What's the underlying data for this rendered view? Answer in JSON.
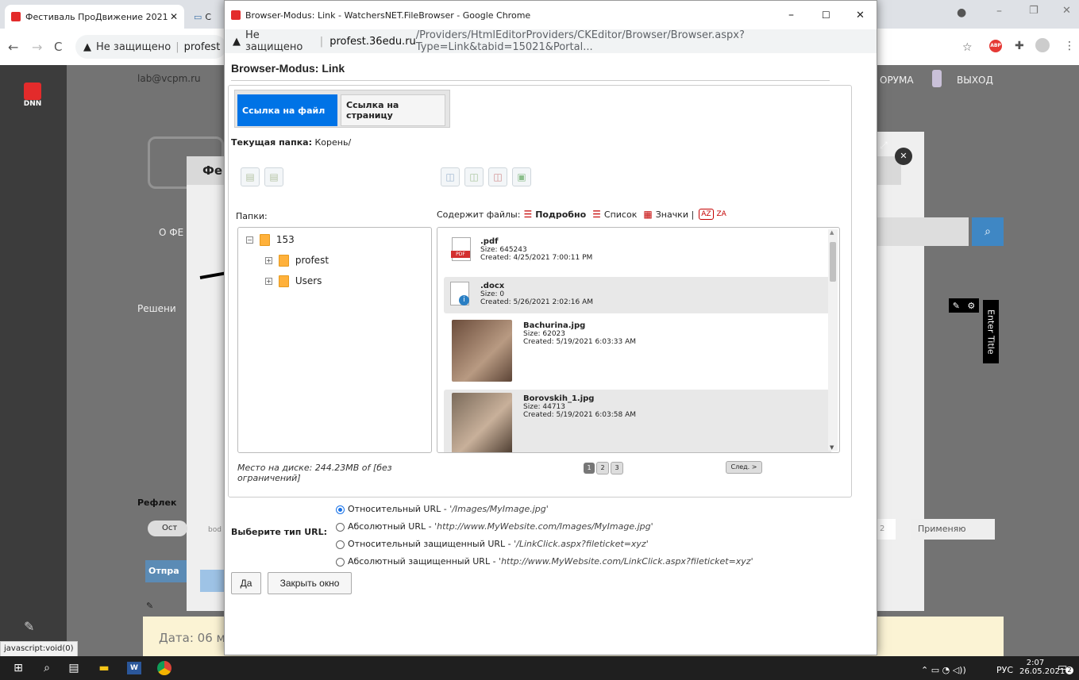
{
  "browser": {
    "tab1_title": "Фестиваль ПроДвижение 2021",
    "tab2_title": "С",
    "address_prefix": "Не защищено",
    "address_text": "profest",
    "status_bar": "javascript:void(0)"
  },
  "background_page": {
    "email": "lab@vcpm.ru",
    "forum_link": "ОРУМА",
    "logout": "ВЫХОД",
    "dnn_label": "DNN",
    "about_fragment": "О ФЕ",
    "decision_fragment": "Решени",
    "reflex_fragment": "Рефлек",
    "ost_fragment": "Ост",
    "send_fragment": "Отпра",
    "date_fragment": "Дата: 06 м",
    "apply_fragment": "Применяю",
    "enter_title": "Enter Title",
    "bod_fragment": "bod",
    "fe_fragment": "Фе",
    "num2": "2"
  },
  "popup": {
    "window_title": "Browser-Modus: Link - WatchersNET.FileBrowser - Google Chrome",
    "address_warning": "Не защищено",
    "url_host": "profest.36edu.ru",
    "url_path": "/Providers/HtmlEditorProviders/CKEditor/Browser/Browser.aspx?Type=Link&tabid=15021&Portal...",
    "heading": "Browser-Modus: Link",
    "tab_file": "Ссылка на файл",
    "tab_page_line1": "Ссылка на",
    "tab_page_line2": "страницу",
    "current_folder_label": "Текущая папка:",
    "current_folder_value": "Корень/",
    "folders_label": "Папки:",
    "files_label": "Содержит файлы:",
    "view_detail": "Подробно",
    "view_list": "Список",
    "view_icons": "Значки |",
    "tree": {
      "root": "153",
      "children": [
        "profest",
        "Users"
      ]
    },
    "files": [
      {
        "name": ".pdf",
        "size": "Size: 645243",
        "created": "Created: 4/25/2021 7:00:11 PM",
        "type": "pdf"
      },
      {
        "name": ".docx",
        "size": "Size: 0",
        "created": "Created: 5/26/2021 2:02:16 AM",
        "type": "doc"
      },
      {
        "name": "Bachurina.jpg",
        "size": "Size: 62023",
        "created": "Created: 5/19/2021 6:03:33 AM",
        "type": "img"
      },
      {
        "name": "Borovskih_1.jpg",
        "size": "Size: 44713",
        "created": "Created: 5/19/2021 6:03:58 AM",
        "type": "img"
      }
    ],
    "disk_space": "Место на диске: 244.23MB of [без ограничений]",
    "pages": [
      "1",
      "2",
      "3"
    ],
    "next_button": "След. >",
    "url_type_label": "Выберите тип URL:",
    "url_options": [
      {
        "label": "Относительный URL - ",
        "example": "'/Images/MyImage.jpg'",
        "checked": true
      },
      {
        "label": "Абсолютный URL - ",
        "example": "'http://www.MyWebsite.com/Images/MyImage.jpg'",
        "checked": false
      },
      {
        "label": "Относительный защищенный URL - ",
        "example": "'/LinkClick.aspx?fileticket=xyz'",
        "checked": false
      },
      {
        "label": "Абсолютный защищенный URL - ",
        "example": "'http://www.MyWebsite.com/LinkClick.aspx?fileticket=xyz'",
        "checked": false
      }
    ],
    "ok_button": "Да",
    "close_button": "Закрыть окно"
  },
  "taskbar": {
    "lang": "РУС",
    "time": "2:07",
    "date": "26.05.2021",
    "notif_count": "2"
  },
  "colors": {
    "accent_blue": "#0073e6",
    "dnn_red": "#e32b2b",
    "folder_orange": "#ffb13b",
    "link_red": "#c40000"
  }
}
